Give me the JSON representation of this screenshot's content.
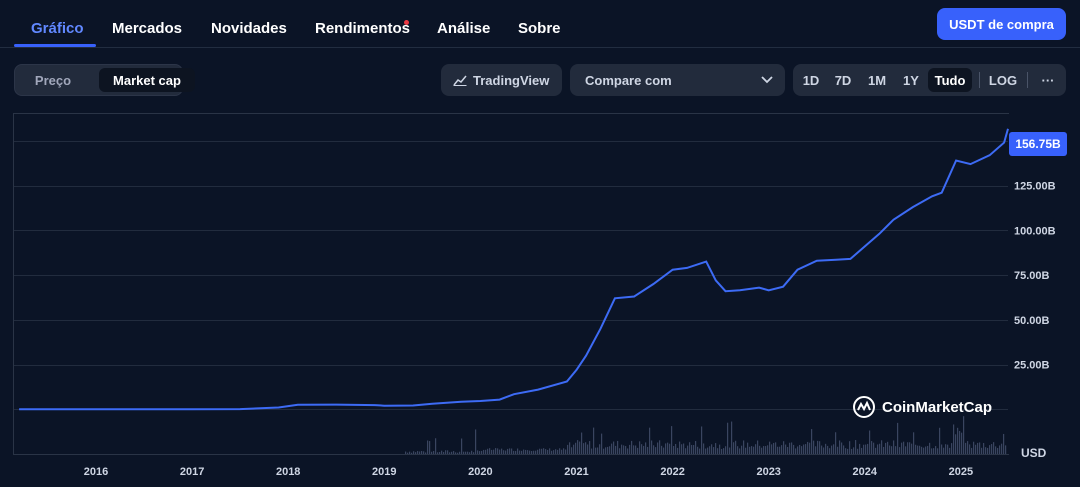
{
  "nav": {
    "tabs": [
      {
        "label": "Gráfico",
        "active": true
      },
      {
        "label": "Mercados"
      },
      {
        "label": "Novidades"
      },
      {
        "label": "Rendimentos",
        "has_dot": true
      },
      {
        "label": "Análise"
      },
      {
        "label": "Sobre"
      }
    ],
    "buy_button": "USDT de compra"
  },
  "toolbar": {
    "toggle": [
      "Preço",
      "Market cap"
    ],
    "toggle_selected": "Market cap",
    "tradingview": "TradingView",
    "compare": "Compare com",
    "ranges": [
      "1D",
      "7D",
      "1M",
      "1Y",
      "Tudo"
    ],
    "range_selected": "Tudo",
    "log": "LOG",
    "more": "···"
  },
  "colors": {
    "accent": "#3861fb",
    "line": "#3d6bf5",
    "background": "#0b1426",
    "volume": "#3a4560"
  },
  "chart_data": {
    "type": "line",
    "x_ticks": [
      "2016",
      "2017",
      "2018",
      "2019",
      "2020",
      "2021",
      "2022",
      "2023",
      "2024",
      "2025"
    ],
    "y_ticks": [
      "25.00B",
      "50.00B",
      "75.00B",
      "100.00B",
      "125.00B"
    ],
    "ylim": [
      -25,
      165
    ],
    "unit": "USD",
    "grid": true,
    "last_value_label": "156.75B",
    "watermark": "CoinMarketCap",
    "series": [
      {
        "values_billion_usd": [
          [
            2015.2,
            0.0
          ],
          [
            2016.0,
            0.0
          ],
          [
            2016.5,
            0.0
          ],
          [
            2017.0,
            0.0
          ],
          [
            2017.5,
            0.1
          ],
          [
            2017.9,
            1.0
          ],
          [
            2018.1,
            2.5
          ],
          [
            2018.5,
            2.6
          ],
          [
            2018.9,
            2.3
          ],
          [
            2019.0,
            2.0
          ],
          [
            2019.3,
            2.1
          ],
          [
            2019.5,
            3.1
          ],
          [
            2019.8,
            4.2
          ],
          [
            2020.0,
            4.6
          ],
          [
            2020.2,
            5.4
          ],
          [
            2020.35,
            8.4
          ],
          [
            2020.6,
            11.0
          ],
          [
            2020.9,
            15.5
          ],
          [
            2021.0,
            22.0
          ],
          [
            2021.1,
            30.0
          ],
          [
            2021.25,
            45.0
          ],
          [
            2021.4,
            62.0
          ],
          [
            2021.6,
            63.0
          ],
          [
            2021.8,
            70.0
          ],
          [
            2022.0,
            78.0
          ],
          [
            2022.15,
            79.0
          ],
          [
            2022.35,
            82.5
          ],
          [
            2022.45,
            72.0
          ],
          [
            2022.55,
            66.0
          ],
          [
            2022.7,
            66.5
          ],
          [
            2022.9,
            68.0
          ],
          [
            2023.0,
            66.5
          ],
          [
            2023.15,
            68.5
          ],
          [
            2023.3,
            78.0
          ],
          [
            2023.5,
            83.0
          ],
          [
            2023.7,
            83.5
          ],
          [
            2023.85,
            84.0
          ],
          [
            2024.0,
            91.0
          ],
          [
            2024.15,
            98.0
          ],
          [
            2024.3,
            106.0
          ],
          [
            2024.5,
            113.0
          ],
          [
            2024.7,
            119.0
          ],
          [
            2024.8,
            121.0
          ],
          [
            2024.95,
            139.0
          ],
          [
            2025.1,
            137.0
          ],
          [
            2025.3,
            142.0
          ],
          [
            2025.45,
            149.0
          ],
          [
            2025.5,
            156.75
          ]
        ]
      }
    ]
  }
}
